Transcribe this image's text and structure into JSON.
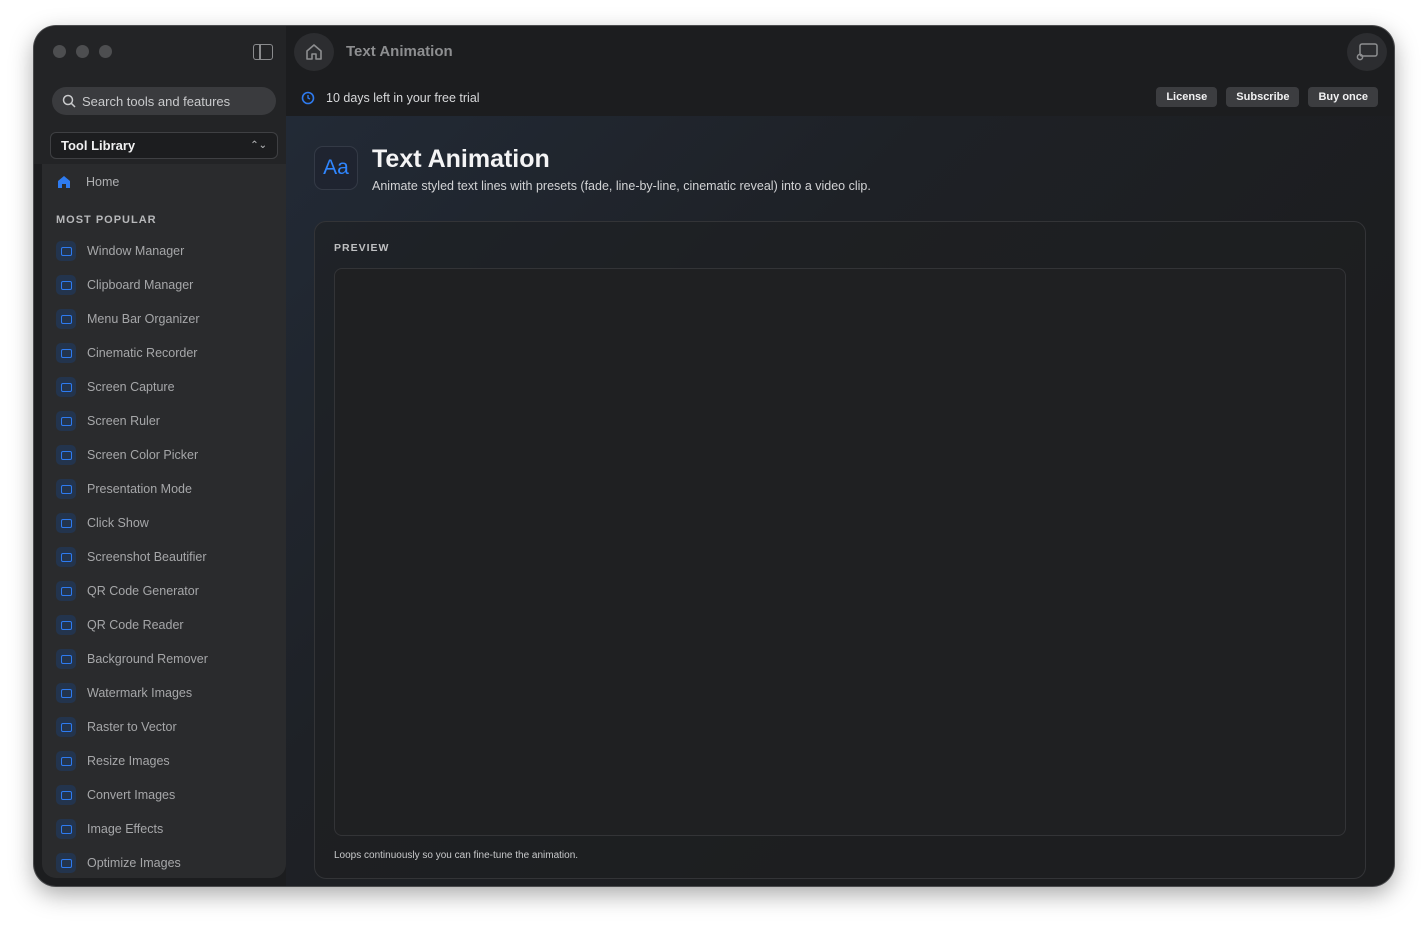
{
  "window_title": "Text Animation",
  "search": {
    "placeholder": "Search tools and features"
  },
  "library_select": "Tool Library",
  "home_label": "Home",
  "section_label": "MOST POPULAR",
  "nav_items": [
    "Window Manager",
    "Clipboard Manager",
    "Menu Bar Organizer",
    "Cinematic Recorder",
    "Screen Capture",
    "Screen Ruler",
    "Screen Color Picker",
    "Presentation Mode",
    "Click Show",
    "Screenshot Beautifier",
    "QR Code Generator",
    "QR Code Reader",
    "Background Remover",
    "Watermark Images",
    "Raster to Vector",
    "Resize Images",
    "Convert Images",
    "Image Effects",
    "Optimize Images"
  ],
  "trial": {
    "text": "10 days left in your free trial",
    "buttons": [
      "License",
      "Subscribe",
      "Buy once"
    ]
  },
  "tool": {
    "icon_text": "Aa",
    "title": "Text Animation",
    "subtitle": "Animate styled text lines with presets (fade, line-by-line, cinematic reveal) into a video clip."
  },
  "preview": {
    "label": "PREVIEW",
    "note": "Loops continuously so you can fine-tune the animation."
  },
  "colors": {
    "accent": "#2e7bf0"
  }
}
